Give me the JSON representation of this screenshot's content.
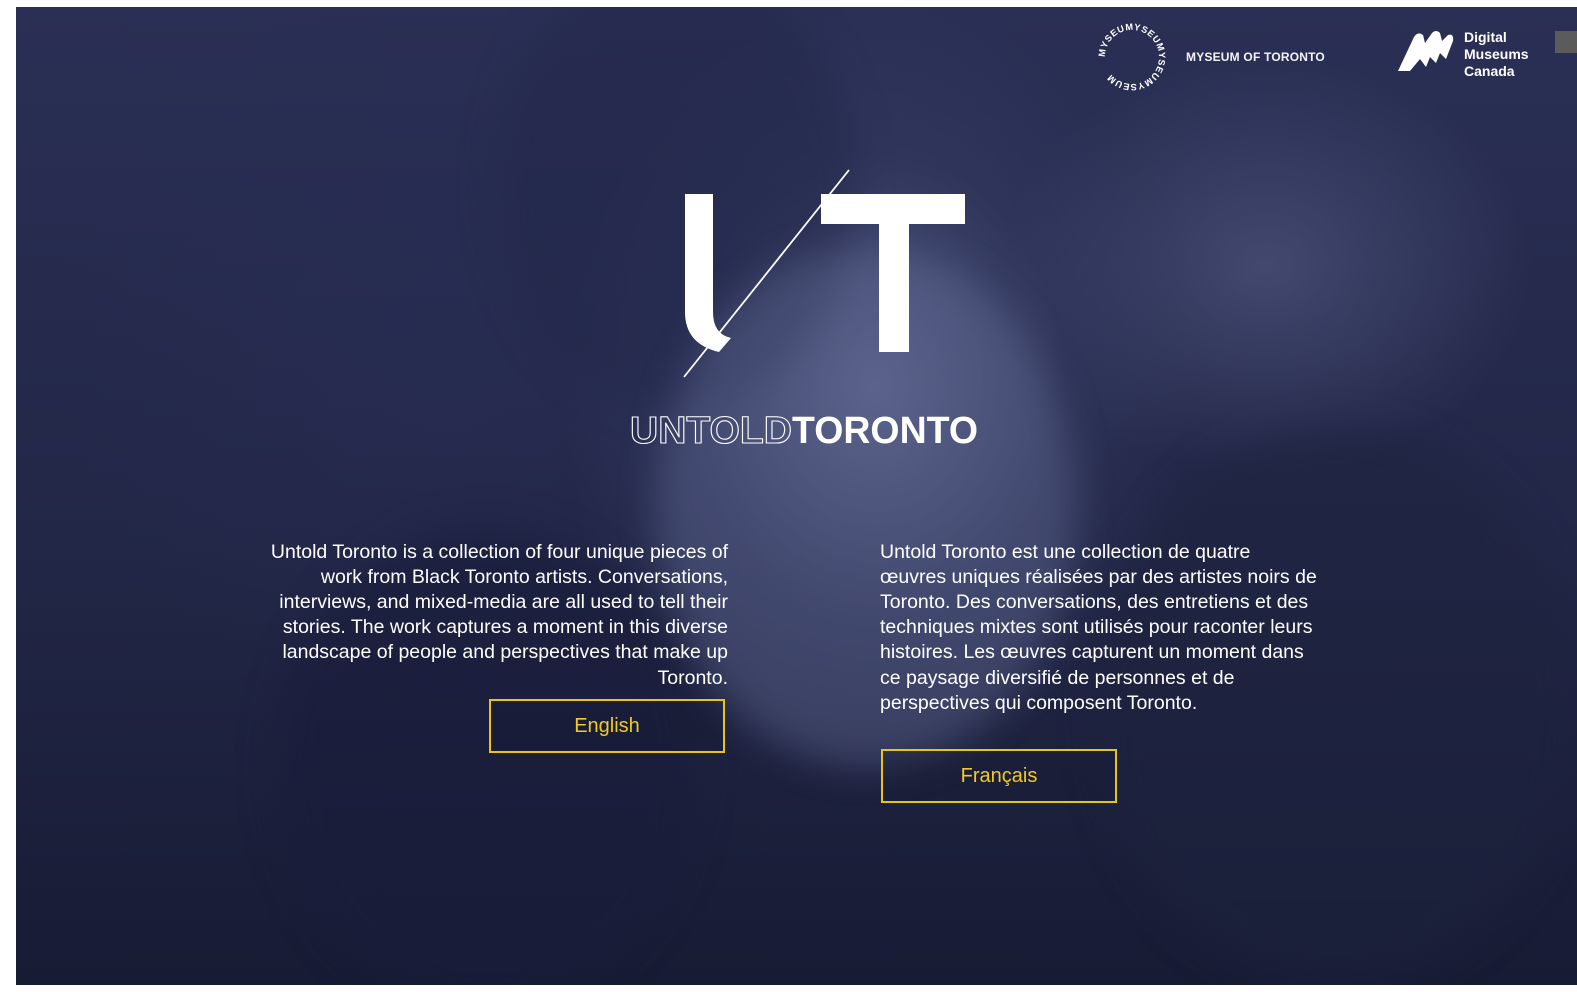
{
  "header": {
    "myseum_ring_text": "MYSEUMYSEUMYSEUMYSEUM",
    "myseum_label": "MYSEUM OF TORONTO",
    "dmc_lines": [
      "Digital",
      "Museums",
      "Canada"
    ]
  },
  "hero": {
    "logo_letters": "UT",
    "wordmark_outline": "UNTOLD",
    "wordmark_solid": "TORONTO"
  },
  "intro": {
    "english": "Untold Toronto is a collection of four unique pieces of work from Black Toronto artists. Conversations, interviews, and mixed-media are all used to tell their stories. The work captures a moment in this diverse landscape of people and perspectives that make up Toronto.",
    "french": "Untold Toronto est une collection de quatre œuvres uniques réalisées par des artistes noirs de Toronto. Des conversations, des entretiens et des techniques mixtes sont utilisés pour raconter leurs histoires. Les œuvres capturent un moment dans ce paysage diversifié de personnes et de perspectives qui composent Toronto."
  },
  "buttons": {
    "english_label": "English",
    "french_label": "Français"
  },
  "colors": {
    "accent": "#e8c21e",
    "background": "#222747",
    "text": "#ffffff"
  }
}
